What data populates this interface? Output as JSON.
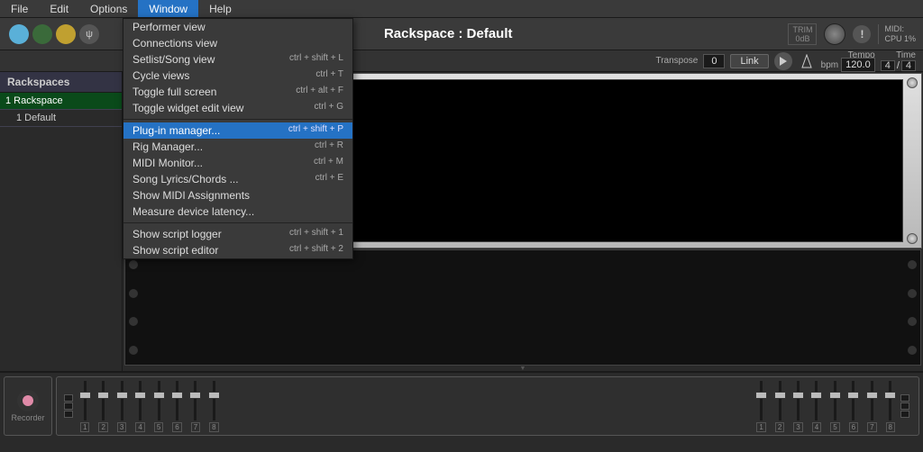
{
  "menubar": [
    "File",
    "Edit",
    "Options",
    "Window",
    "Help"
  ],
  "active_menu_index": 3,
  "window_menu": [
    {
      "label": "Performer view",
      "shortcut": ""
    },
    {
      "label": "Connections view",
      "shortcut": ""
    },
    {
      "label": "Setlist/Song view",
      "shortcut": "ctrl + shift + L"
    },
    {
      "label": "Cycle views",
      "shortcut": "ctrl + T"
    },
    {
      "label": "Toggle full screen",
      "shortcut": "ctrl + alt + F"
    },
    {
      "label": "Toggle widget edit view",
      "shortcut": "ctrl + G"
    },
    {
      "sep": true
    },
    {
      "label": "Plug-in manager...",
      "shortcut": "ctrl + shift + P",
      "highlighted": true
    },
    {
      "label": "Rig Manager...",
      "shortcut": "ctrl + R"
    },
    {
      "label": "MIDI Monitor...",
      "shortcut": "ctrl + M"
    },
    {
      "label": "Song Lyrics/Chords ...",
      "shortcut": "ctrl + E"
    },
    {
      "label": "Show MIDI Assignments",
      "shortcut": ""
    },
    {
      "label": "Measure device latency...",
      "shortcut": ""
    },
    {
      "sep": true
    },
    {
      "label": "Show script logger",
      "shortcut": "ctrl + shift + 1"
    },
    {
      "label": "Show script editor",
      "shortcut": "ctrl + shift + 2"
    }
  ],
  "title": "Rackspace : Default",
  "trim": {
    "label": "TRIM",
    "value": "0dB"
  },
  "midi": {
    "label": "MIDI:",
    "cpu_label": "CPU",
    "cpu_value": "1%"
  },
  "transport": {
    "transpose_label": "Transpose",
    "transpose_value": "0",
    "link_label": "Link",
    "tempo_label": "Tempo",
    "bpm_label": "bpm",
    "bpm_value": "120.0",
    "time_label": "Time",
    "time_num": "4",
    "time_sep": "/",
    "time_den": "4"
  },
  "sidebar": {
    "header": "Rackspaces",
    "rackspace": "1 Rackspace",
    "variation": "1  Default"
  },
  "recorder_label": "Recorder",
  "fader_numbers_left": [
    "1",
    "2",
    "3",
    "4",
    "5",
    "6",
    "7",
    "8"
  ],
  "fader_numbers_right": [
    "1",
    "2",
    "3",
    "4",
    "5",
    "6",
    "7",
    "8"
  ]
}
